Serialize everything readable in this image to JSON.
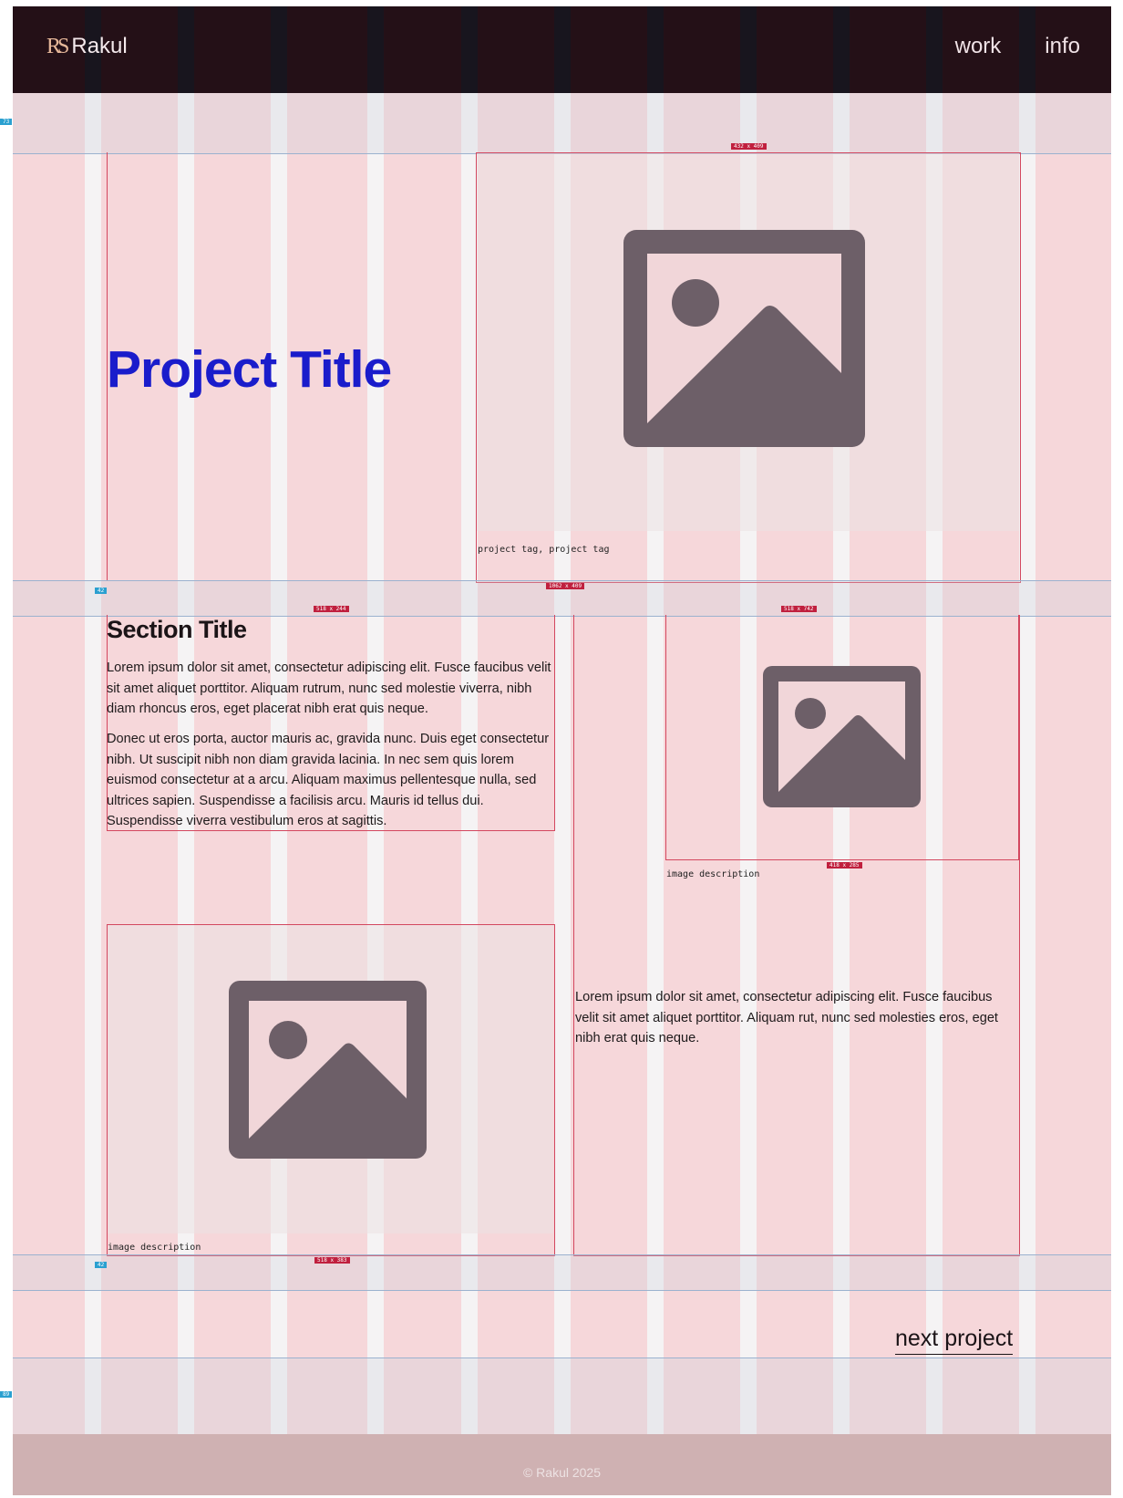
{
  "header": {
    "logo_mark": "RS",
    "logo_text": "Rakul",
    "nav": [
      {
        "label": "work"
      },
      {
        "label": "info"
      }
    ]
  },
  "hero": {
    "title": "Project Title",
    "tags": "project tag, project tag",
    "image_dims": "432 x 409",
    "row_dims": "1062 x 409"
  },
  "section": {
    "title": "Section Title",
    "text_dims": "518 x 244",
    "paragraph1": "Lorem ipsum dolor sit amet, consectetur adipiscing elit. Fusce faucibus velit sit amet aliquet porttitor. Aliquam rutrum, nunc sed molestie viverra, nibh diam rhoncus eros, eget placerat nibh erat quis neque.",
    "paragraph2": "Donec ut eros porta, auctor mauris ac, gravida nunc. Duis eget consectetur nibh. Ut suscipit nibh non diam gravida lacinia. In nec sem quis lorem euismod consectetur at a arcu. Aliquam maximus pellentesque nulla, sed ultrices sapien. Suspendisse a facilisis arcu. Mauris id tellus dui. Suspendisse viverra vestibulum eros at sagittis.",
    "right_column_dims": "518 x 742",
    "right_image_dims": "418 x 285",
    "right_image_caption": "image description",
    "right_paragraph": "Lorem ipsum dolor sit amet, consectetur adipiscing elit. Fusce faucibus velit sit amet aliquet porttitor. Aliquam rut, nunc sed molesties eros, eget nibh erat quis neque.",
    "left_image_caption": "image description",
    "left_image_dims": "518 x 383"
  },
  "spacing_labels": [
    "73",
    "42",
    "42",
    "89"
  ],
  "next_project": "next project",
  "footer": {
    "text": "© Rakul 2025"
  },
  "colors": {
    "accent": "#1a1ccb",
    "header_bg": "#241017",
    "overlay": "#f6d7da"
  }
}
